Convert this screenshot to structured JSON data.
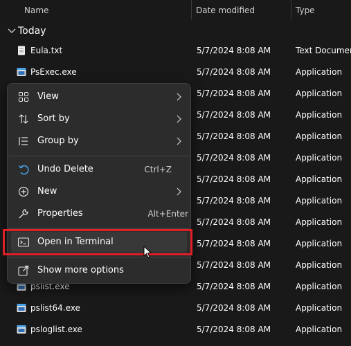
{
  "columns": {
    "name": "Name",
    "date": "Date modified",
    "type": "Type"
  },
  "group": {
    "label": "Today",
    "icon": "chevron-down-icon"
  },
  "files": [
    {
      "name": "Eula.txt",
      "date": "5/7/2024 8:08 AM",
      "type": "Text Document",
      "icon": "text-file-icon"
    },
    {
      "name": "PsExec.exe",
      "date": "5/7/2024 8:08 AM",
      "type": "Application",
      "icon": "app-icon"
    },
    {
      "name": "",
      "date": "5/7/2024 8:08 AM",
      "type": "Application",
      "icon": "app-icon"
    },
    {
      "name": "",
      "date": "5/7/2024 8:08 AM",
      "type": "Application",
      "icon": "app-icon"
    },
    {
      "name": "",
      "date": "5/7/2024 8:08 AM",
      "type": "Application",
      "icon": "app-icon"
    },
    {
      "name": "",
      "date": "5/7/2024 8:08 AM",
      "type": "Application",
      "icon": "app-icon"
    },
    {
      "name": "",
      "date": "5/7/2024 8:08 AM",
      "type": "Application",
      "icon": "app-icon"
    },
    {
      "name": "",
      "date": "5/7/2024 8:08 AM",
      "type": "Application",
      "icon": "app-icon"
    },
    {
      "name": "",
      "date": "5/7/2024 8:08 AM",
      "type": "Application",
      "icon": "app-icon"
    },
    {
      "name": "",
      "date": "5/7/2024 8:08 AM",
      "type": "Application",
      "icon": "app-icon"
    },
    {
      "name": "",
      "date": "5/7/2024 8:08 AM",
      "type": "Application",
      "icon": "app-icon"
    },
    {
      "name": "pslist.exe",
      "date": "5/7/2024 8:08 AM",
      "type": "Application",
      "icon": "app-icon"
    },
    {
      "name": "pslist64.exe",
      "date": "5/7/2024 8:08 AM",
      "type": "Application",
      "icon": "app-icon"
    },
    {
      "name": "psloglist.exe",
      "date": "5/7/2024 8:08 AM",
      "type": "Application",
      "icon": "app-icon"
    }
  ],
  "context_menu": {
    "view": {
      "label": "View",
      "icon": "grid-view-icon"
    },
    "sort_by": {
      "label": "Sort by",
      "icon": "sort-arrows-icon"
    },
    "group_by": {
      "label": "Group by",
      "icon": "group-list-icon"
    },
    "undo_delete": {
      "label": "Undo Delete",
      "shortcut": "Ctrl+Z",
      "icon": "undo-icon"
    },
    "new": {
      "label": "New",
      "icon": "plus-circle-icon"
    },
    "properties": {
      "label": "Properties",
      "shortcut": "Alt+Enter",
      "icon": "wrench-icon"
    },
    "open_terminal": {
      "label": "Open in Terminal",
      "icon": "terminal-icon"
    },
    "show_more": {
      "label": "Show more options",
      "icon": "share-box-icon"
    }
  },
  "colors": {
    "background": "#191919",
    "menu_background": "#2c2c2c",
    "highlight_border": "#e01f26",
    "accent": "#4aa3e8"
  }
}
